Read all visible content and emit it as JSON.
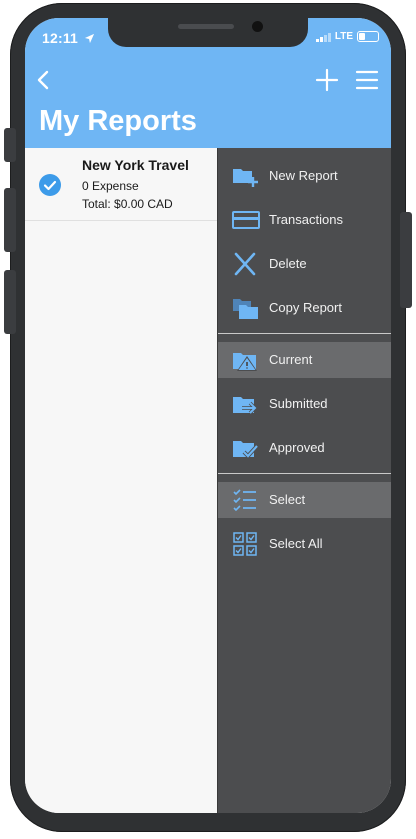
{
  "status_bar": {
    "time": "12:11",
    "network": "LTE"
  },
  "header": {
    "title": "My Reports"
  },
  "reports": [
    {
      "title": "New York Travel",
      "expenses": "0 Expense",
      "total": "Total: $0.00 CAD",
      "selected": true
    }
  ],
  "side_menu": {
    "actions": [
      {
        "label": "New Report",
        "icon": "folder-add-icon"
      },
      {
        "label": "Transactions",
        "icon": "credit-card-icon"
      },
      {
        "label": "Delete",
        "icon": "delete-x-icon"
      },
      {
        "label": "Copy Report",
        "icon": "copy-folder-icon"
      }
    ],
    "filters": [
      {
        "label": "Current",
        "icon": "folder-warning-icon",
        "active": true
      },
      {
        "label": "Submitted",
        "icon": "folder-arrow-icon",
        "active": false
      },
      {
        "label": "Approved",
        "icon": "folder-check-icon",
        "active": false
      }
    ],
    "selection": [
      {
        "label": "Select",
        "icon": "checklist-icon",
        "active": true
      },
      {
        "label": "Select All",
        "icon": "select-all-icon",
        "active": false
      }
    ]
  },
  "colors": {
    "header": "#6fb6f4",
    "accent": "#3d9be9",
    "menu_bg": "#4c4d4f",
    "menu_active": "#6a6b6d"
  }
}
